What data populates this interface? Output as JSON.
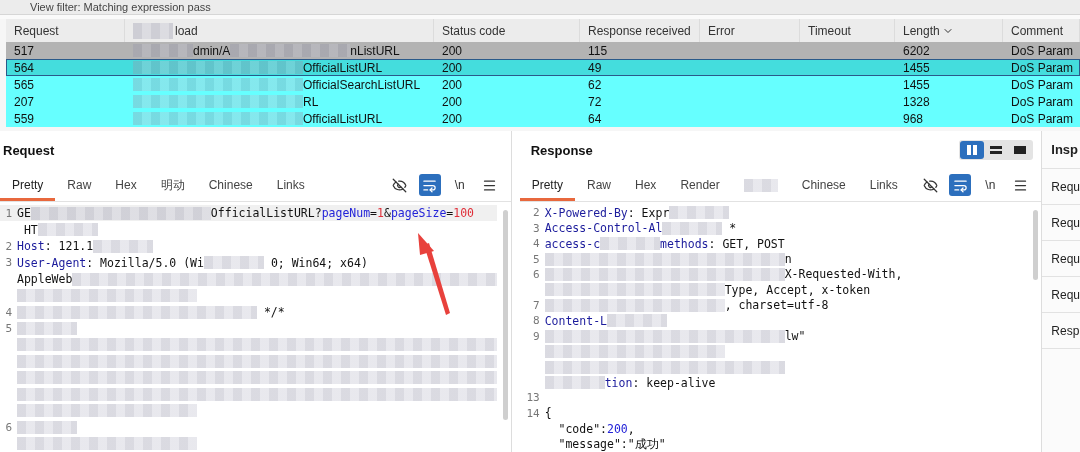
{
  "filter_bar": {
    "text": "View filter: Matching expression pass"
  },
  "results_table": {
    "columns": [
      {
        "label": "Request",
        "redacted": false,
        "sorted": false
      },
      {
        "label": "load",
        "redacted": true,
        "sorted": false
      },
      {
        "label": "Status code",
        "redacted": false,
        "sorted": false
      },
      {
        "label": "Response received",
        "redacted": false,
        "sorted": false
      },
      {
        "label": "Error",
        "redacted": false,
        "sorted": false
      },
      {
        "label": "Timeout",
        "redacted": false,
        "sorted": false
      },
      {
        "label": "Length",
        "redacted": false,
        "sorted": true
      },
      {
        "label": "Comment",
        "redacted": false,
        "sorted": false
      }
    ],
    "rows": [
      {
        "request": "517",
        "payload": [
          "dmin/A",
          "nListURL"
        ],
        "status": "200",
        "received": "115",
        "length": "6202",
        "comment": "DoS Param",
        "color": "#b3b3b3",
        "selected": false
      },
      {
        "request": "564",
        "payload": [
          "OfficialListURL"
        ],
        "status": "200",
        "received": "49",
        "length": "1455",
        "comment": "DoS Param",
        "color": "#44dddd",
        "selected": true
      },
      {
        "request": "565",
        "payload": [
          "OfficialSearchListURL"
        ],
        "status": "200",
        "received": "62",
        "length": "1455",
        "comment": "DoS Param",
        "color": "#66ffff",
        "selected": false
      },
      {
        "request": "207",
        "payload": [
          "RL"
        ],
        "status": "200",
        "received": "72",
        "length": "1328",
        "comment": "DoS Param",
        "color": "#66ffff",
        "selected": false
      },
      {
        "request": "559",
        "payload": [
          "OfficialListURL"
        ],
        "status": "200",
        "received": "64",
        "length": "968",
        "comment": "DoS Param",
        "color": "#66ffff",
        "selected": false
      }
    ]
  },
  "request_pane": {
    "title": "Request",
    "tabs": [
      {
        "kind": "text",
        "label": "Pretty",
        "selected": true
      },
      {
        "kind": "text",
        "label": "Raw",
        "selected": false
      },
      {
        "kind": "text",
        "label": "Hex",
        "selected": false
      },
      {
        "kind": "text",
        "label": "明动",
        "selected": false
      },
      {
        "kind": "text",
        "label": "Chinese",
        "selected": false
      },
      {
        "kind": "text",
        "label": "Links",
        "selected": false
      }
    ],
    "tools": [
      {
        "kind": "hide",
        "selected": false
      },
      {
        "kind": "wrap",
        "selected": true
      },
      {
        "kind": "newline",
        "label": "\\n",
        "selected": false
      },
      {
        "kind": "menu",
        "selected": false
      }
    ],
    "annotation": {
      "kind": "arrow"
    },
    "lines": [
      {
        "number": "1",
        "current": true,
        "segments": [
          {
            "kind": "text",
            "text": "GE"
          },
          {
            "kind": "redact_long"
          },
          {
            "kind": "text",
            "text": "OfficialListURL?"
          },
          {
            "kind": "param",
            "text": "pageNum"
          },
          {
            "kind": "text",
            "text": "="
          },
          {
            "kind": "value",
            "text": "1"
          },
          {
            "kind": "text",
            "text": "&"
          },
          {
            "kind": "param",
            "text": "pageSize"
          },
          {
            "kind": "text",
            "text": "="
          },
          {
            "kind": "value",
            "text": "100"
          }
        ]
      },
      {
        "current": false,
        "segments": [
          {
            "kind": "text",
            "text": " HT"
          },
          {
            "kind": "redact_short"
          }
        ]
      },
      {
        "number": "2",
        "current": false,
        "segments": [
          {
            "kind": "key",
            "text": "Host"
          },
          {
            "kind": "text",
            "text": ": 121.1"
          },
          {
            "kind": "redact_short"
          }
        ]
      },
      {
        "number": "3",
        "current": false,
        "segments": [
          {
            "kind": "key",
            "text": "User-Agent"
          },
          {
            "kind": "text",
            "text": ": Mozilla/5.0 (Wi"
          },
          {
            "kind": "redact_short"
          },
          {
            "kind": "text",
            "text": " 0; Win64; x64)"
          }
        ]
      },
      {
        "current": false,
        "segments": [
          {
            "kind": "text",
            "text": "AppleWeb"
          },
          {
            "kind": "redact_full"
          }
        ]
      },
      {
        "current": false,
        "segments": [
          {
            "kind": "redact_long"
          }
        ]
      },
      {
        "number": "4",
        "current": false,
        "segments": [
          {
            "kind": "redact_long"
          },
          {
            "kind": "redact_short"
          },
          {
            "kind": "text",
            "text": " */*"
          }
        ]
      },
      {
        "number": "5",
        "current": false,
        "segments": [
          {
            "kind": "redact_short"
          }
        ]
      },
      {
        "current": false,
        "segments": [
          {
            "kind": "redact_full"
          }
        ]
      },
      {
        "current": false,
        "segments": [
          {
            "kind": "redact_full"
          }
        ]
      },
      {
        "current": false,
        "segments": [
          {
            "kind": "redact_full"
          }
        ]
      },
      {
        "current": false,
        "segments": [
          {
            "kind": "redact_full"
          }
        ]
      },
      {
        "current": false,
        "segments": [
          {
            "kind": "redact_long"
          }
        ]
      },
      {
        "number": "6",
        "current": false,
        "segments": [
          {
            "kind": "redact_short"
          }
        ]
      },
      {
        "current": false,
        "segments": [
          {
            "kind": "redact_long"
          }
        ]
      }
    ]
  },
  "response_pane": {
    "title": "Response",
    "layout_buttons": [
      {
        "kind": "columns",
        "selected": true
      },
      {
        "kind": "rows",
        "selected": false
      },
      {
        "kind": "single",
        "selected": false
      }
    ],
    "tabs": [
      {
        "kind": "text",
        "label": "Pretty",
        "selected": true
      },
      {
        "kind": "text",
        "label": "Raw",
        "selected": false
      },
      {
        "kind": "text",
        "label": "Hex",
        "selected": false
      },
      {
        "kind": "text",
        "label": "Render",
        "selected": false
      },
      {
        "kind": "redacted",
        "selected": false
      },
      {
        "kind": "text",
        "label": "Chinese",
        "selected": false
      },
      {
        "kind": "text",
        "label": "Links",
        "selected": false
      }
    ],
    "tools": [
      {
        "kind": "hide",
        "selected": false
      },
      {
        "kind": "wrap",
        "selected": true
      },
      {
        "kind": "newline",
        "label": "\\n",
        "selected": false
      },
      {
        "kind": "menu",
        "selected": false
      }
    ],
    "lines": [
      {
        "number": "2",
        "current": false,
        "segments": [
          {
            "kind": "key",
            "text": "X-Powered-By"
          },
          {
            "kind": "text",
            "text": ": Expr"
          },
          {
            "kind": "redact_short"
          }
        ]
      },
      {
        "number": "3",
        "current": false,
        "segments": [
          {
            "kind": "key",
            "text": "Access-Control-Al"
          },
          {
            "kind": "redact_short"
          },
          {
            "kind": "text",
            "text": " *"
          }
        ]
      },
      {
        "number": "4",
        "current": false,
        "segments": [
          {
            "kind": "key",
            "text": "access-c"
          },
          {
            "kind": "redact_short"
          },
          {
            "kind": "key",
            "text": "methods"
          },
          {
            "kind": "text",
            "text": ": GET, POST"
          }
        ]
      },
      {
        "number": "5",
        "current": false,
        "segments": [
          {
            "kind": "redact_long"
          },
          {
            "kind": "redact_short"
          },
          {
            "kind": "text",
            "text": "n"
          }
        ]
      },
      {
        "number": "6",
        "current": false,
        "segments": [
          {
            "kind": "redact_long"
          },
          {
            "kind": "redact_short"
          },
          {
            "kind": "text",
            "text": "X-Requested-With,"
          }
        ]
      },
      {
        "current": false,
        "segments": [
          {
            "kind": "redact_long"
          },
          {
            "kind": "text",
            "text": "Type, Accept, x-token"
          }
        ]
      },
      {
        "number": "7",
        "current": false,
        "segments": [
          {
            "kind": "redact_long"
          },
          {
            "kind": "text",
            "text": ", charset=utf-8"
          }
        ]
      },
      {
        "number": "8",
        "current": false,
        "segments": [
          {
            "kind": "key",
            "text": "Content-L"
          },
          {
            "kind": "redact_short"
          }
        ]
      },
      {
        "number": "9",
        "current": false,
        "segments": [
          {
            "kind": "redact_long"
          },
          {
            "kind": "redact_short"
          },
          {
            "kind": "text",
            "text": "lw\""
          }
        ]
      },
      {
        "current": false,
        "segments": [
          {
            "kind": "redact_long"
          }
        ]
      },
      {
        "current": false,
        "segments": [
          {
            "kind": "redact_long"
          },
          {
            "kind": "redact_short"
          }
        ]
      },
      {
        "current": false,
        "segments": [
          {
            "kind": "redact_short"
          },
          {
            "kind": "key",
            "text": "tion"
          },
          {
            "kind": "text",
            "text": ": keep-alive"
          }
        ]
      },
      {
        "number": "13",
        "current": false
      },
      {
        "number": "14",
        "current": false,
        "segments": [
          {
            "kind": "text",
            "text": "{"
          }
        ]
      },
      {
        "current": false,
        "segments": [
          {
            "kind": "text",
            "text": "  \"code\":"
          },
          {
            "kind": "num",
            "text": "200"
          },
          {
            "kind": "text",
            "text": ","
          }
        ]
      },
      {
        "current": false,
        "segments": [
          {
            "kind": "text",
            "text": "  \"message\":\"成功\""
          }
        ]
      }
    ]
  },
  "inspector": {
    "title": "Insp",
    "items": [
      "Requ",
      "Requ",
      "Requ",
      "Requ",
      "Resp"
    ]
  }
}
